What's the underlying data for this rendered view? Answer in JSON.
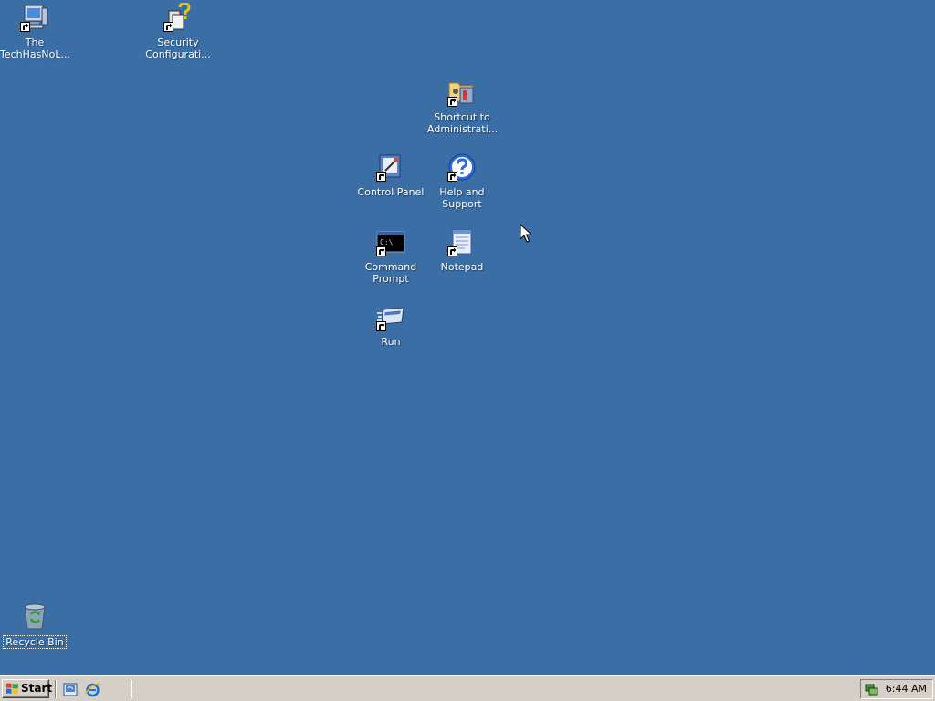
{
  "desktop": {
    "background": "#3a6ea5",
    "icons": [
      {
        "name": "The TechHasNoL...",
        "lines": [
          "The",
          "TechHasNoL..."
        ],
        "icon": "my-computer-icon",
        "shortcut": true
      },
      {
        "name": "Security Configurati...",
        "lines": [
          "Security",
          "Configurati..."
        ],
        "icon": "security-config-icon",
        "shortcut": true
      },
      {
        "name": "Shortcut to Administrati...",
        "lines": [
          "Shortcut to",
          "Administrati..."
        ],
        "icon": "admin-tools-icon",
        "shortcut": true
      },
      {
        "name": "Control Panel",
        "lines": [
          "Control Panel"
        ],
        "icon": "control-panel-icon",
        "shortcut": true
      },
      {
        "name": "Help and Support",
        "lines": [
          "Help and",
          "Support"
        ],
        "icon": "help-icon",
        "shortcut": true
      },
      {
        "name": "Command Prompt",
        "lines": [
          "Command",
          "Prompt"
        ],
        "icon": "command-prompt-icon",
        "shortcut": true
      },
      {
        "name": "Notepad",
        "lines": [
          "Notepad"
        ],
        "icon": "notepad-icon",
        "shortcut": true
      },
      {
        "name": "Run",
        "lines": [
          "Run"
        ],
        "icon": "run-icon",
        "shortcut": true
      },
      {
        "name": "Recycle Bin",
        "lines": [
          "Recycle Bin"
        ],
        "icon": "recycle-bin-icon",
        "shortcut": false,
        "selected": true
      }
    ]
  },
  "taskbar": {
    "start_label": "Start",
    "quick_launch": [
      {
        "icon": "show-desktop-icon"
      },
      {
        "icon": "internet-explorer-icon"
      }
    ],
    "tray": {
      "icon": "network-icon",
      "clock": "6:44 AM"
    }
  }
}
